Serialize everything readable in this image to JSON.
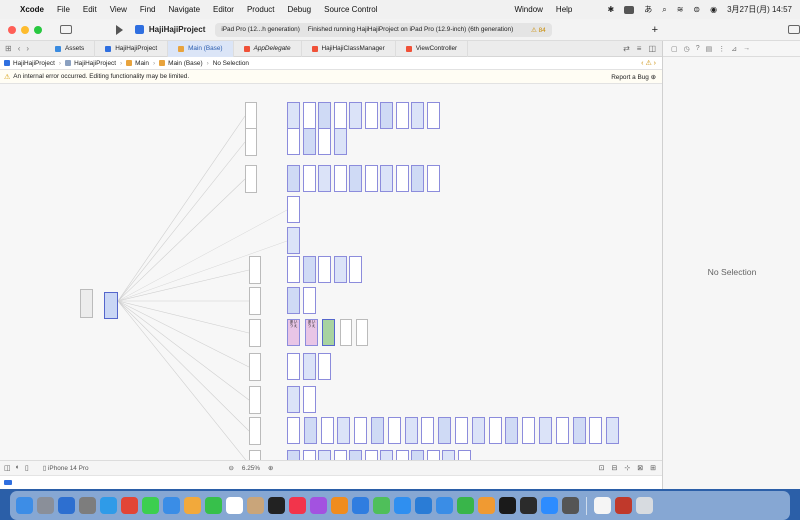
{
  "menubar": {
    "app_name": "Xcode",
    "items": [
      "File",
      "Edit",
      "View",
      "Find",
      "Navigate",
      "Editor",
      "Product",
      "Debug",
      "Source Control",
      "Window",
      "Help"
    ],
    "input_mode": "あ",
    "datetime": "3月27日(月)  14:57"
  },
  "toolbar": {
    "scheme": "HajiHajiProject",
    "destination": "iPad Pro (12...h generation)",
    "status": "Finished running HajiHajiProject on iPad Pro (12.9-inch) (6th generation)",
    "warning_count": "84"
  },
  "tabs": [
    {
      "label": "Assets",
      "icon": "asset-catalog-icon",
      "color": "#3a8be0",
      "active": false,
      "italic": false
    },
    {
      "label": "HajiHajiProject",
      "icon": "project-icon",
      "color": "#2f6fe0",
      "active": false,
      "italic": false
    },
    {
      "label": "Main (Base)",
      "icon": "storyboard-icon",
      "color": "#e8a33d",
      "active": true,
      "italic": false
    },
    {
      "label": "AppDelegate",
      "icon": "swift-file-icon",
      "color": "#f05138",
      "active": false,
      "italic": true
    },
    {
      "label": "HajiHajiClassManager",
      "icon": "swift-file-icon",
      "color": "#f05138",
      "active": false,
      "italic": false
    },
    {
      "label": "ViewController",
      "icon": "swift-file-icon",
      "color": "#f05138",
      "active": false,
      "italic": false
    }
  ],
  "breadcrumb": [
    "HajiHajiProject",
    "HajiHajiProject",
    "Main",
    "Main (Base)",
    "No Selection"
  ],
  "warning_bar": {
    "message": "An internal error occurred. Editing functionality may be limited.",
    "report_label": "Report a Bug"
  },
  "editor_bottom": {
    "device": "iPhone 14 Pro",
    "zoom": "6.25%"
  },
  "inspector": {
    "empty_label": "No Selection"
  },
  "storyboard_text": {
    "hiragana_label": "あいうえ"
  },
  "dock": [
    {
      "name": "finder-icon",
      "color": "#3d8de6"
    },
    {
      "name": "launchpad-icon",
      "color": "#8a8f99"
    },
    {
      "name": "mission-control-icon",
      "color": "#2d6fd0"
    },
    {
      "name": "system-settings-icon",
      "color": "#7d7d7d"
    },
    {
      "name": "safari-icon",
      "color": "#2f9be8"
    },
    {
      "name": "chrome-icon",
      "color": "#e24536"
    },
    {
      "name": "messages-icon",
      "color": "#3ccf4f"
    },
    {
      "name": "mail-icon",
      "color": "#3a8de6"
    },
    {
      "name": "photos-icon",
      "color": "#f2a93b"
    },
    {
      "name": "facetime-icon",
      "color": "#37c04b"
    },
    {
      "name": "calendar-icon",
      "color": "#ffffff"
    },
    {
      "name": "contacts-icon",
      "color": "#c9a57a"
    },
    {
      "name": "tv-icon",
      "color": "#222222"
    },
    {
      "name": "music-icon",
      "color": "#f2344b"
    },
    {
      "name": "podcasts-icon",
      "color": "#a352e0"
    },
    {
      "name": "books-icon",
      "color": "#f08c1e"
    },
    {
      "name": "keynote-icon",
      "color": "#2f7de0"
    },
    {
      "name": "maps-icon",
      "color": "#4fbf5a"
    },
    {
      "name": "app-store-icon",
      "color": "#2f8ff0"
    },
    {
      "name": "vscode-icon",
      "color": "#2a7cd6"
    },
    {
      "name": "xcode-icon",
      "color": "#3a8de6"
    },
    {
      "name": "numbers-icon",
      "color": "#39b54a"
    },
    {
      "name": "pages-icon",
      "color": "#f09a32"
    },
    {
      "name": "codepoint-icon",
      "color": "#1a1a1a"
    },
    {
      "name": "terminal-icon",
      "color": "#2b2b2b"
    },
    {
      "name": "zoom-icon",
      "color": "#2d8cff"
    },
    {
      "name": "calculator-icon",
      "color": "#555555"
    },
    {
      "name": "textedit-icon",
      "color": "#f5f5f5"
    },
    {
      "name": "input-method-icon",
      "color": "#c0392b"
    },
    {
      "name": "trash-icon",
      "color": "#d7dbe0"
    }
  ]
}
